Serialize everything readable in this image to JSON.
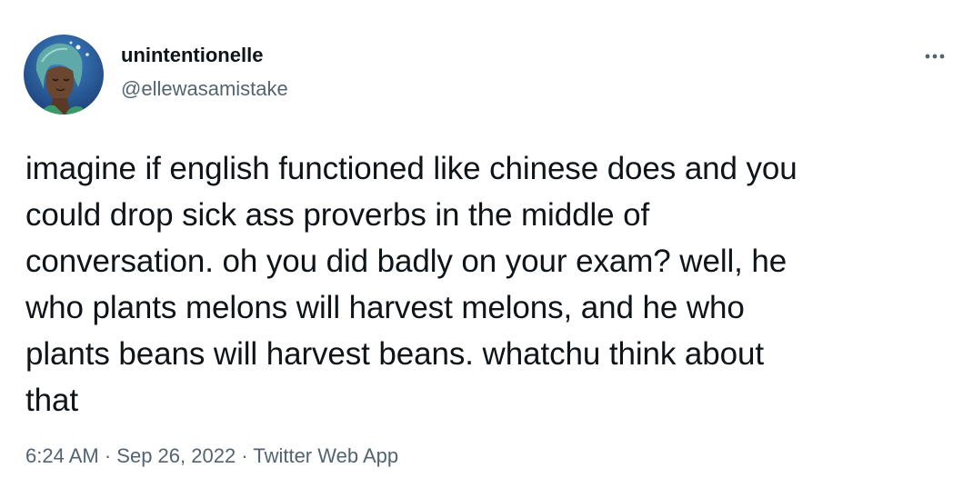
{
  "author": {
    "display_name": "unintentionelle",
    "handle": "@ellewasamistake",
    "avatar_icon": "profile-avatar"
  },
  "tweet": {
    "text": "imagine if english functioned like chinese does and you\ncould drop sick ass proverbs in the middle of\nconversation. oh you did badly on your exam? well, he\nwho plants melons will harvest melons, and he who\nplants beans will harvest beans. whatchu think about\nthat"
  },
  "meta": {
    "time": "6:24 AM",
    "separator": " · ",
    "date": "Sep 26, 2022",
    "source": "Twitter Web App"
  },
  "more_icon": "more-dots",
  "colors": {
    "text_primary": "#0f1419",
    "text_secondary": "#536471",
    "background": "#ffffff"
  }
}
